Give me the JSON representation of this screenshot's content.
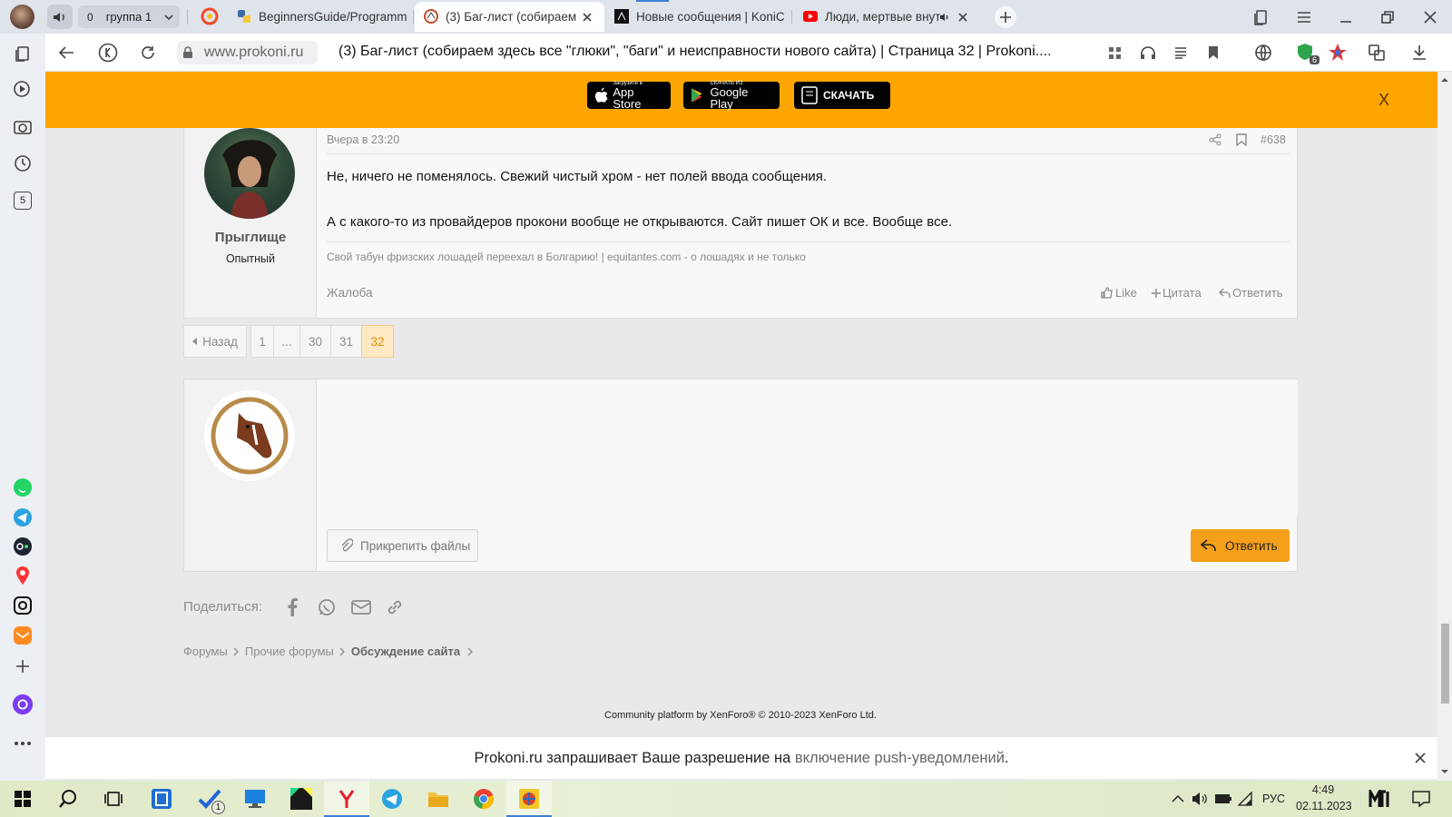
{
  "browser": {
    "tab_group_count": "0",
    "tab_group_label": "группа 1",
    "tabs": [
      {
        "label": "BeginnersGuide/Programm"
      },
      {
        "label": "(3) Баг-лист (собираем"
      },
      {
        "label": "Новые сообщения | KoniC"
      },
      {
        "label": "Люди, мертвые внут"
      }
    ],
    "url_domain": "www.prokoni.ru",
    "page_title": "(3) Баг-лист (собираем здесь все \"глюки\", \"баги\" и неисправности нового сайта) | Страница 32 | Prokoni....",
    "ext_badge": "6",
    "sidebar_badge": "5"
  },
  "banner": {
    "appstore_small": "Загрузите в",
    "appstore_label": "App Store",
    "google_small": "СКАЧАТЬ ИЗ",
    "google_label": "Google Play",
    "download_label": "СКАЧАТЬ",
    "close": "X"
  },
  "post": {
    "date": "Вчера в 23:20",
    "number": "#638",
    "author": "Прыглище",
    "rank": "Опытный",
    "line1": "Не, ничего не поменялось. Свежий чистый хром - нет полей ввода сообщения.",
    "line2": "А с какого-то из провайдеров прокони вообще не открываются. Сайт пишет ОК и все. Вообще все.",
    "signature": "Свой табун фризских лошадей переехал в Болгарию! | equitantes.com - о лошадях и не только",
    "report": "Жалоба",
    "like": "Like",
    "quote": "Цитата",
    "reply": "Ответить"
  },
  "pagination": {
    "back": "Назад",
    "pages": [
      "1",
      "...",
      "30",
      "31",
      "32"
    ],
    "current": "32"
  },
  "reply_box": {
    "attach": "Прикрепить файлы",
    "submit": "Ответить"
  },
  "share": {
    "label": "Поделиться:"
  },
  "breadcrumbs": [
    "Форумы",
    "Прочие форумы",
    "Обсуждение сайта"
  ],
  "footer": {
    "copyright": "Community platform by XenForo® © 2010-2023 XenForo Ltd."
  },
  "notification": {
    "text": "Prokoni.ru запрашивает Ваше разрешение на ",
    "link": "включение push-уведомлений",
    "end": "."
  },
  "taskbar": {
    "language": "РУС",
    "time": "4:49",
    "date": "02.11.2023",
    "task_badge": "1"
  },
  "colors": {
    "accent": "#ffa500",
    "reply_button": "#f5a01a",
    "current_page": "#ffe9c4"
  }
}
